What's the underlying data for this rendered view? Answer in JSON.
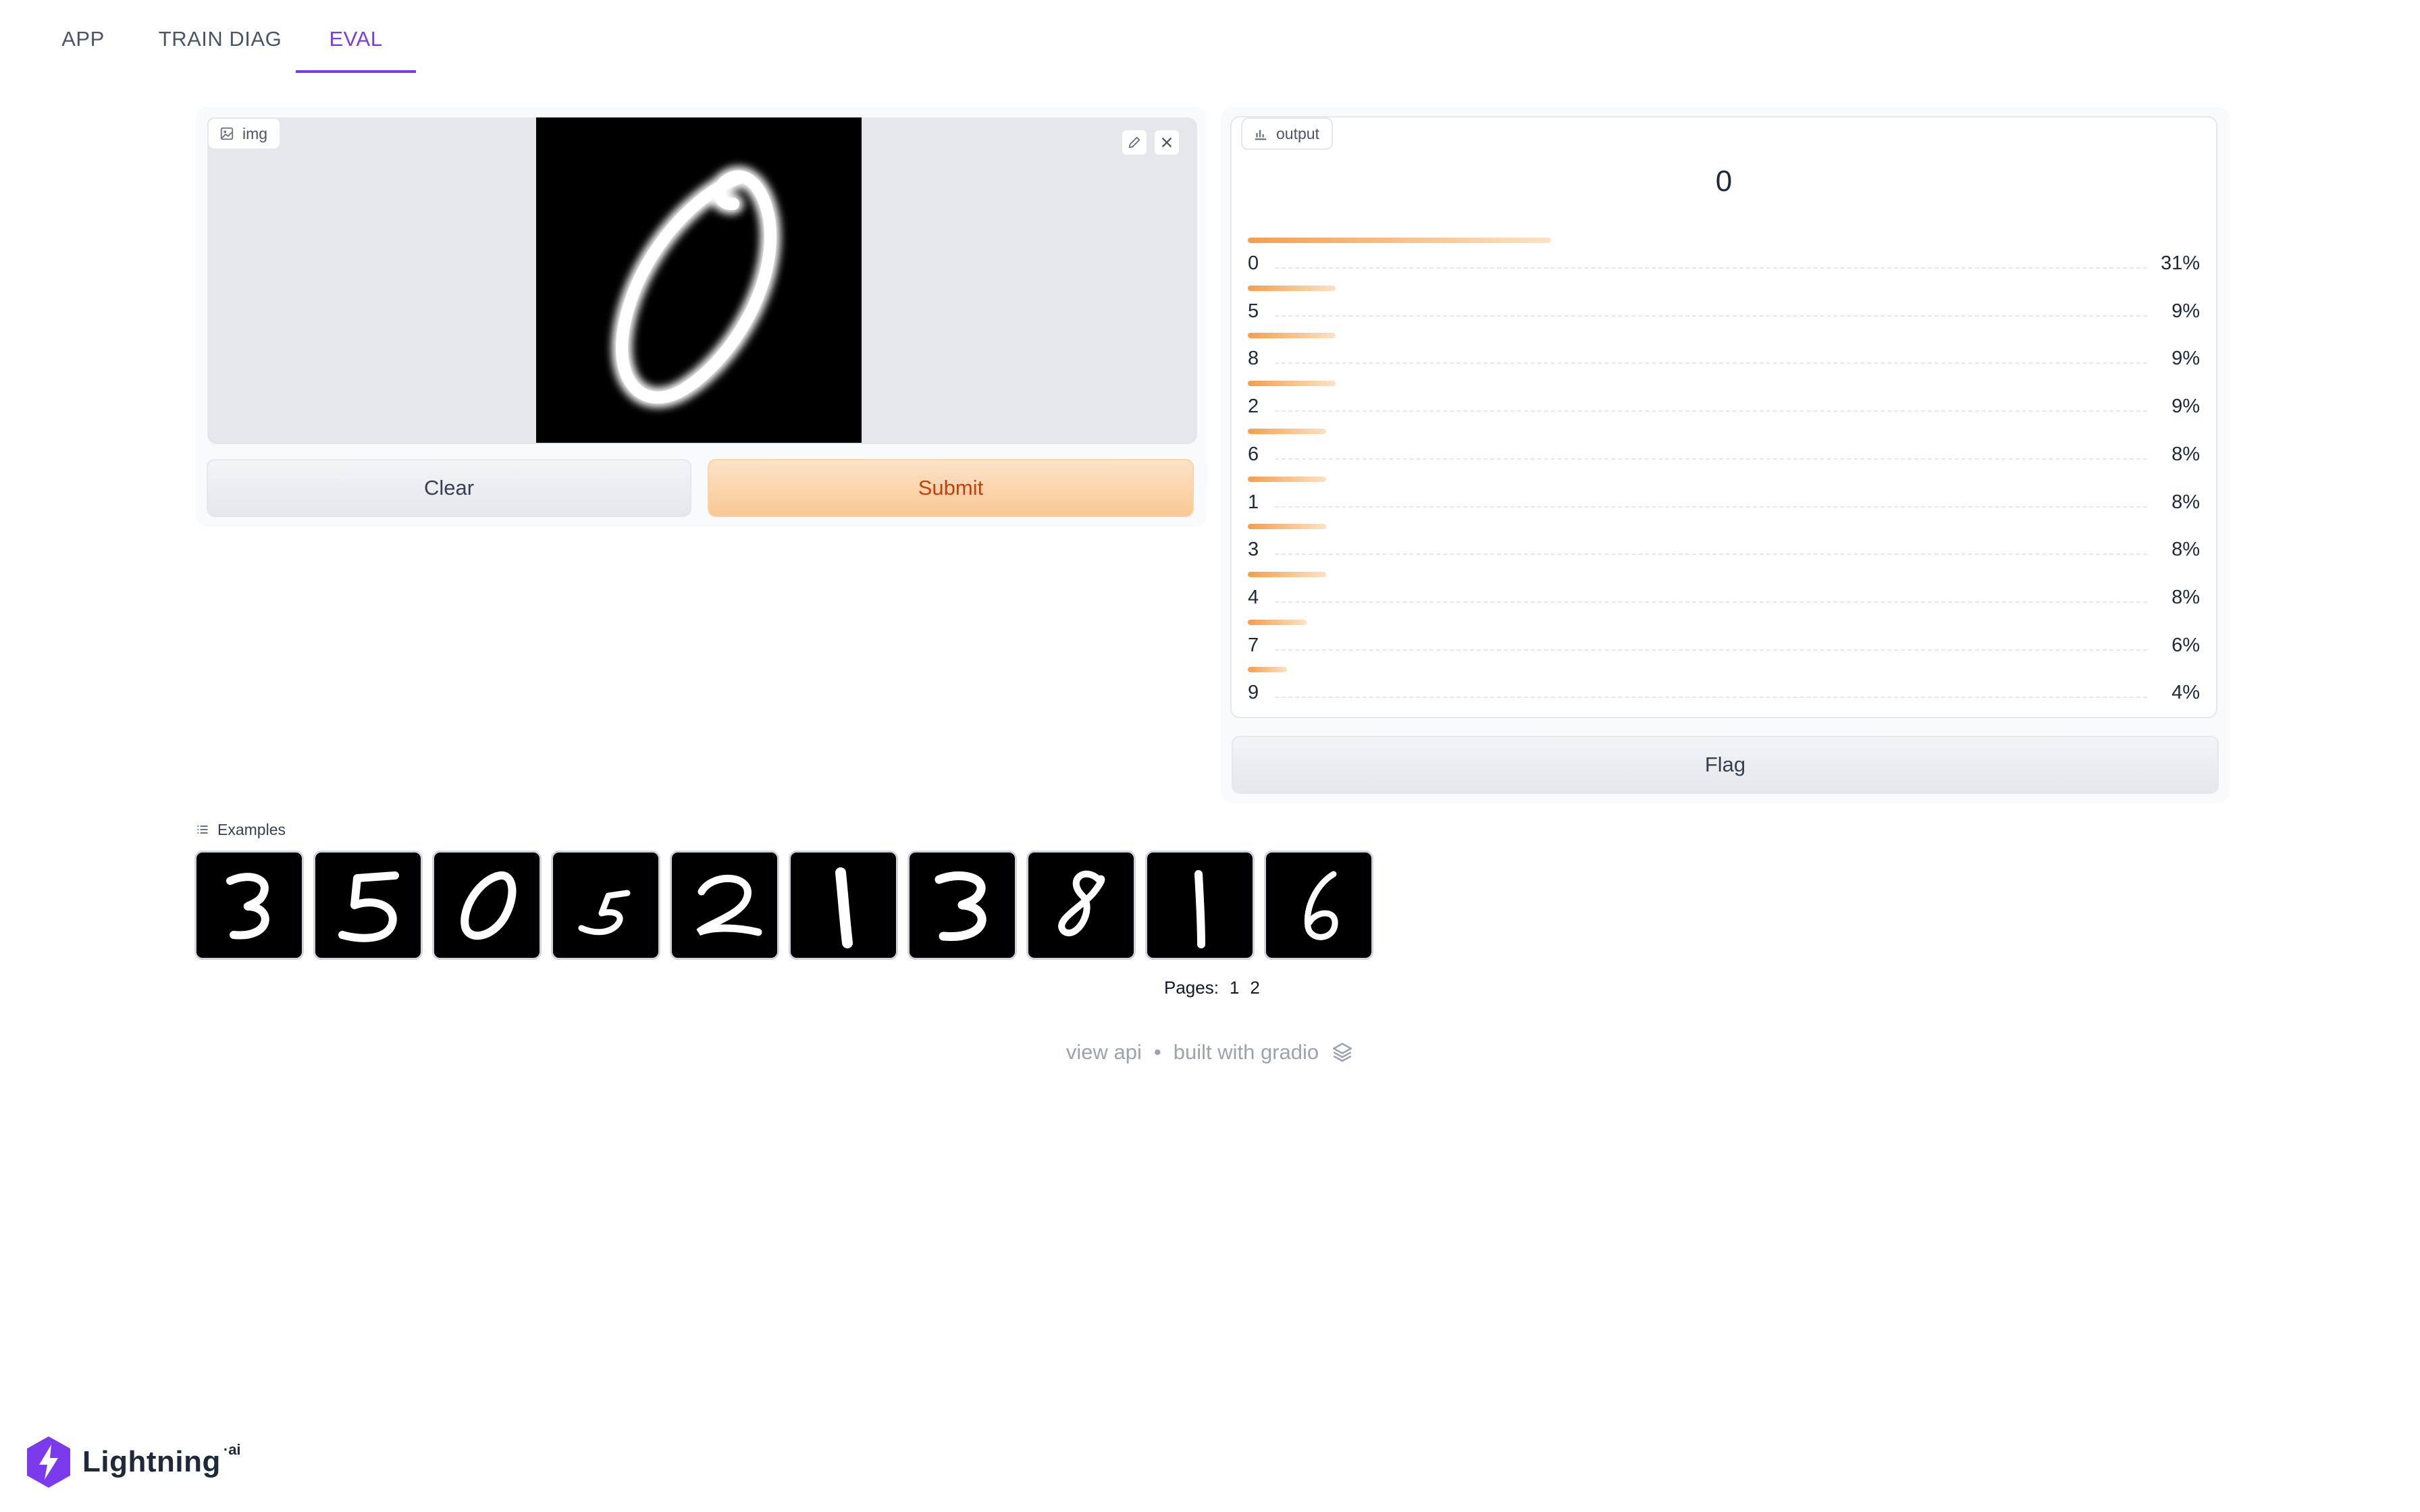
{
  "tabs": [
    {
      "label": "APP",
      "active": false
    },
    {
      "label": "TRAIN DIAG",
      "active": false
    },
    {
      "label": "EVAL",
      "active": true
    }
  ],
  "input_panel": {
    "label": "img",
    "label_icon": "image-icon",
    "edit_icon": "pencil-icon",
    "clear_icon": "close-icon",
    "clear_button": "Clear",
    "submit_button": "Submit"
  },
  "output_panel": {
    "label": "output",
    "label_icon": "bar-chart-icon",
    "top_label": "0",
    "confidences": [
      {
        "label": "0",
        "value": 0.31,
        "text": "31%"
      },
      {
        "label": "5",
        "value": 0.09,
        "text": "9%"
      },
      {
        "label": "8",
        "value": 0.09,
        "text": "9%"
      },
      {
        "label": "2",
        "value": 0.09,
        "text": "9%"
      },
      {
        "label": "6",
        "value": 0.08,
        "text": "8%"
      },
      {
        "label": "1",
        "value": 0.08,
        "text": "8%"
      },
      {
        "label": "3",
        "value": 0.08,
        "text": "8%"
      },
      {
        "label": "4",
        "value": 0.08,
        "text": "8%"
      },
      {
        "label": "7",
        "value": 0.06,
        "text": "6%"
      },
      {
        "label": "9",
        "value": 0.04,
        "text": "4%"
      }
    ],
    "flag_button": "Flag"
  },
  "examples": {
    "label": "Examples",
    "label_icon": "list-icon",
    "pages_label": "Pages:",
    "pages": [
      "1",
      "2"
    ]
  },
  "footer": {
    "view_api": "view api",
    "separator": "•",
    "built_with": "built with gradio",
    "logo_icon": "gradio-logo-icon"
  },
  "brand": {
    "name": "Lightning",
    "suffix": "·ai",
    "logo_icon": "lightning-bolt-icon"
  },
  "colors": {
    "accent": "#7c3aed",
    "primary_button": "#f9c894",
    "bar": "#f59e4c"
  }
}
